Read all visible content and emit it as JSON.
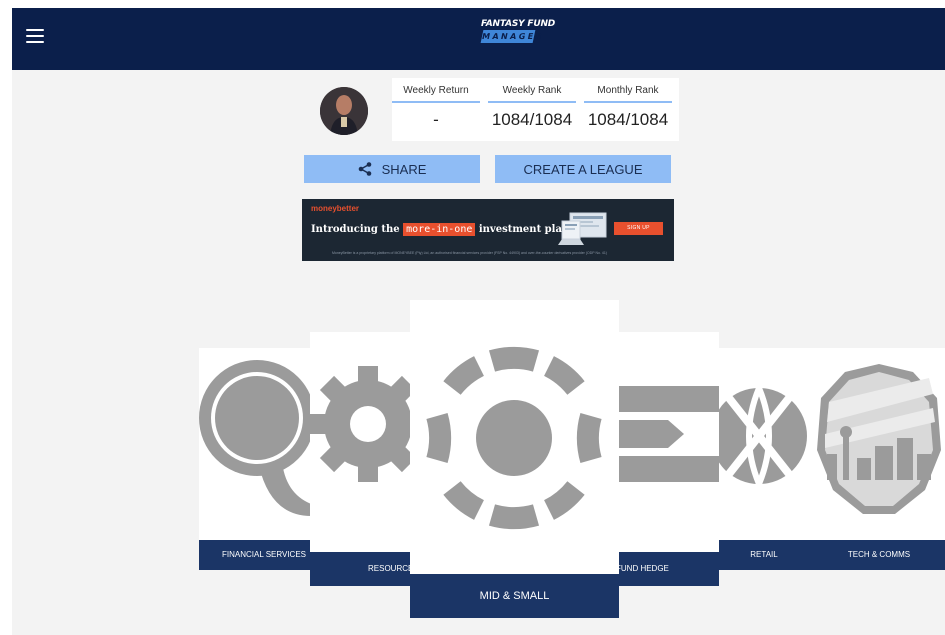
{
  "header": {
    "logo_line1": "FANTASY FUND",
    "logo_line2": "MANAGER"
  },
  "stats": {
    "weekly_return_label": "Weekly Return",
    "weekly_return_value": "-",
    "weekly_rank_label": "Weekly Rank",
    "weekly_rank_value": "1084/1084",
    "monthly_rank_label": "Monthly Rank",
    "monthly_rank_value": "1084/1084"
  },
  "actions": {
    "share_label": "SHARE",
    "create_league_label": "CREATE A LEAGUE"
  },
  "ad": {
    "brand": "moneybetter",
    "headline_prefix": "Introducing the",
    "headline_highlight": "more-in-one",
    "headline_suffix": "investment platform",
    "cta": "SIGN UP",
    "fine_print": "MoneyBetter is a proprietary platform of MONEYBEE (Pty) Ltd, an authorised financial services provider (FSP No. 44903) and over-the-counter derivatives provider (ODP No. 41)"
  },
  "carousel": {
    "cards": [
      {
        "label": "FINANCIAL SERVICES",
        "icon": "magnifier-icon"
      },
      {
        "label": "RESOURCES",
        "icon": "gear-icon"
      },
      {
        "label": "MID & SMALL",
        "icon": "segmented-circle-icon"
      },
      {
        "label": "FUND HEDGE",
        "icon": "flag-icon"
      },
      {
        "label": "RETAIL",
        "icon": "globe-icon"
      },
      {
        "label": "TECH & COMMS",
        "icon": "city-badge-icon"
      }
    ]
  },
  "colors": {
    "navy": "#0b1f4b",
    "card_label": "#1b3566",
    "button": "#8fbcf5",
    "icon_gray": "#9b9b9b",
    "ad_accent": "#e8502e"
  }
}
